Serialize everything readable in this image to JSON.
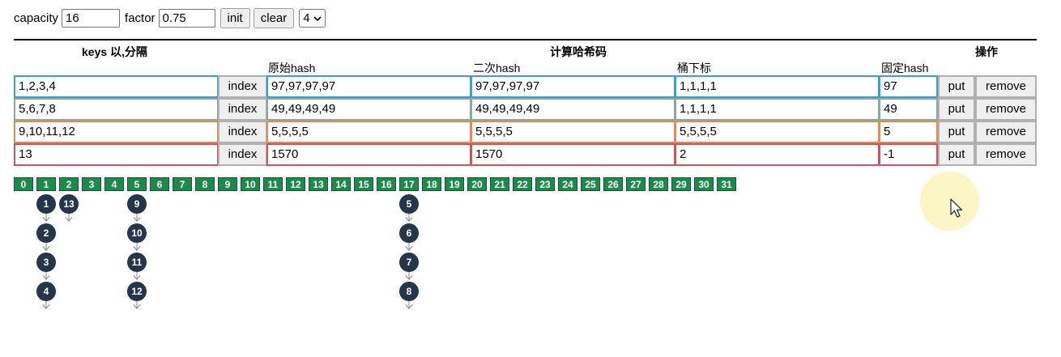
{
  "controls": {
    "capacity_label": "capacity",
    "capacity_value": "16",
    "factor_label": "factor",
    "factor_value": "0.75",
    "init_label": "init",
    "clear_label": "clear",
    "select_value": "4"
  },
  "headers": {
    "keys": "keys 以,分隔",
    "compute": "计算哈希码",
    "ops": "操作",
    "orig_hash": "原始hash",
    "second_hash": "二次hash",
    "bucket_index": "桶下标",
    "fixed_hash": "固定hash"
  },
  "rows": [
    {
      "keys": "1,2,3,4",
      "index": "index",
      "orig": "97,97,97,97",
      "second": "97,97,97,97",
      "bucket": "1,1,1,1",
      "fixed": "97",
      "put": "put",
      "remove": "remove",
      "color": "#3b9fd4"
    },
    {
      "keys": "5,6,7,8",
      "index": "index",
      "orig": "49,49,49,49",
      "second": "49,49,49,49",
      "bucket": "1,1,1,1",
      "fixed": "49",
      "put": "put",
      "remove": "remove",
      "color": "#8aa8a0"
    },
    {
      "keys": "9,10,11,12",
      "index": "index",
      "orig": "5,5,5,5",
      "second": "5,5,5,5",
      "bucket": "5,5,5,5",
      "fixed": "5",
      "put": "put",
      "remove": "remove",
      "color": "#e48a54"
    },
    {
      "keys": "13",
      "index": "index",
      "orig": "1570",
      "second": "1570",
      "bucket": "2",
      "fixed": "-1",
      "put": "put",
      "remove": "remove",
      "color": "#c8555f"
    }
  ],
  "buckets": [
    "0",
    "1",
    "2",
    "3",
    "4",
    "5",
    "6",
    "7",
    "8",
    "9",
    "10",
    "11",
    "12",
    "13",
    "14",
    "15",
    "16",
    "17",
    "18",
    "19",
    "20",
    "21",
    "22",
    "23",
    "24",
    "25",
    "26",
    "27",
    "28",
    "29",
    "30",
    "31"
  ],
  "chains": [
    {
      "bucket": "1",
      "nodes": [
        "1",
        "2",
        "3",
        "4"
      ]
    },
    {
      "bucket": "2",
      "nodes": [
        "13"
      ]
    },
    {
      "bucket": "5",
      "nodes": [
        "9",
        "10",
        "11",
        "12"
      ]
    },
    {
      "bucket": "17",
      "nodes": [
        "5",
        "6",
        "7",
        "8"
      ]
    }
  ],
  "colors": {
    "bucket": "#1e8a4a",
    "node": "#26364a"
  }
}
